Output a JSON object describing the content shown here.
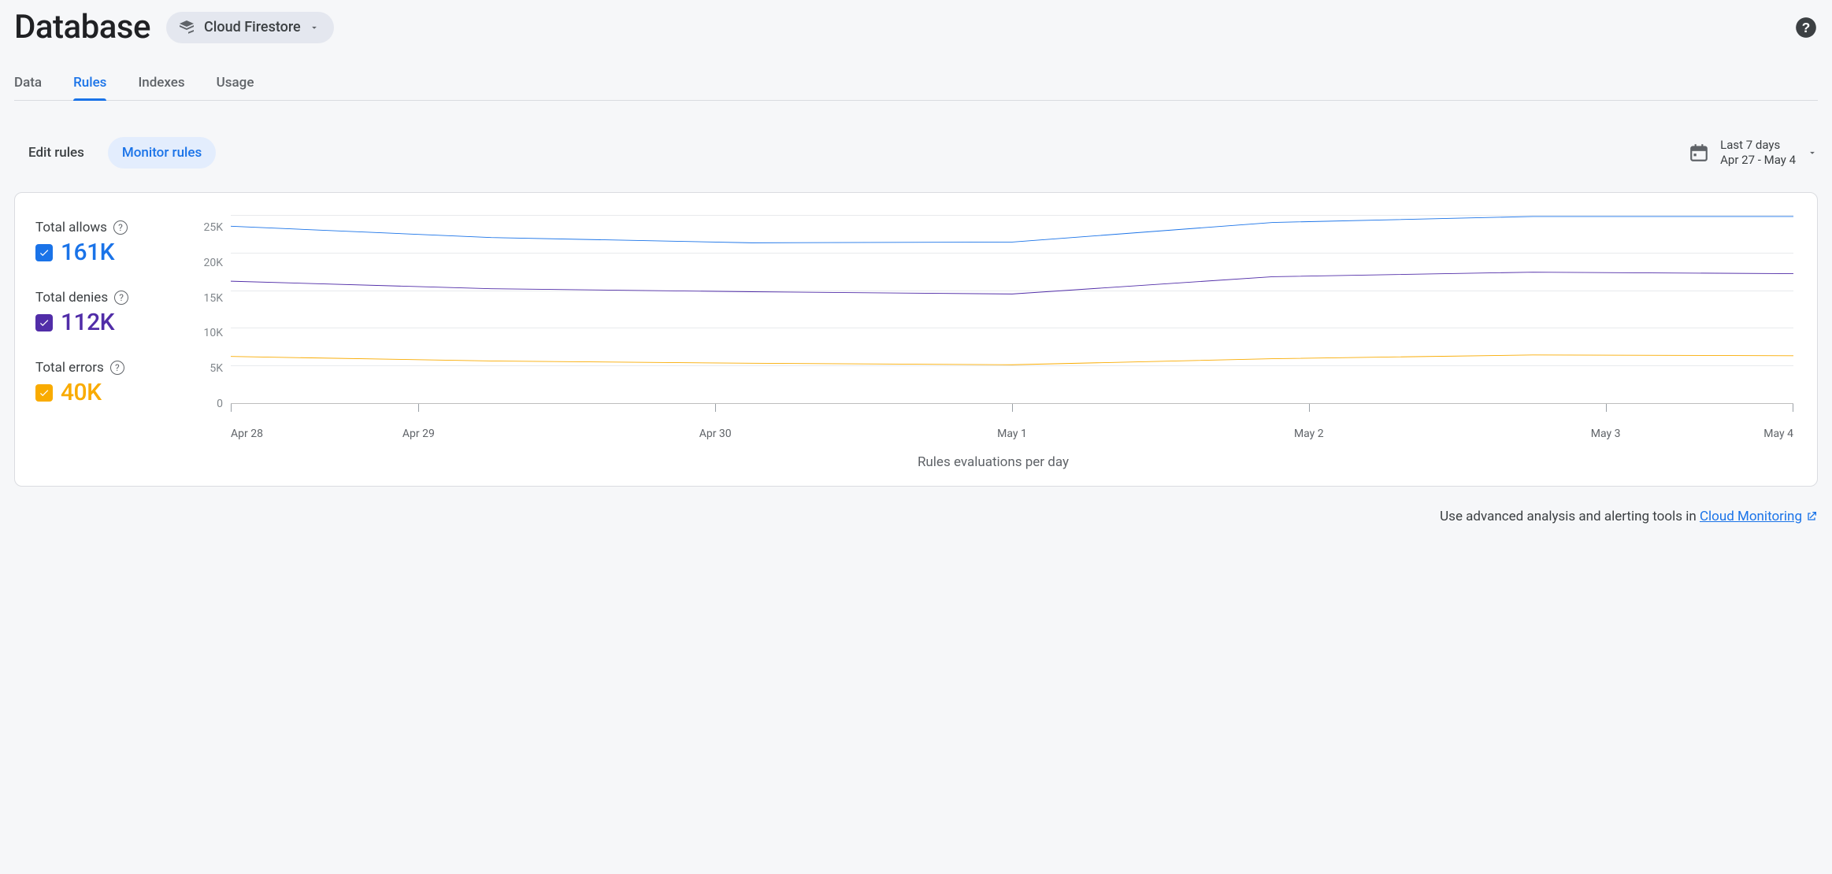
{
  "header": {
    "title": "Database",
    "chip_label": "Cloud Firestore"
  },
  "main_tabs": [
    {
      "key": "data",
      "label": "Data",
      "active": false
    },
    {
      "key": "rules",
      "label": "Rules",
      "active": true
    },
    {
      "key": "indexes",
      "label": "Indexes",
      "active": false
    },
    {
      "key": "usage",
      "label": "Usage",
      "active": false
    }
  ],
  "sub_tabs": [
    {
      "key": "edit",
      "label": "Edit rules",
      "active": false
    },
    {
      "key": "monitor",
      "label": "Monitor rules",
      "active": true
    }
  ],
  "date_range": {
    "label": "Last 7 days",
    "range": "Apr 27 - May 4"
  },
  "metrics": [
    {
      "key": "allows",
      "label": "Total allows",
      "value": "161K",
      "color": "#1a73e8"
    },
    {
      "key": "denies",
      "label": "Total denies",
      "value": "112K",
      "color": "#512da8"
    },
    {
      "key": "errors",
      "label": "Total errors",
      "value": "40K",
      "color": "#f9ab00"
    }
  ],
  "chart_data": {
    "type": "line",
    "title": "",
    "xlabel": "Rules evaluations per day",
    "ylabel": "",
    "categories": [
      "Apr 28",
      "Apr 29",
      "Apr 30",
      "May 1",
      "May 2",
      "May 3",
      "May 4"
    ],
    "y_ticks": [
      "25K",
      "20K",
      "15K",
      "10K",
      "5K",
      "0"
    ],
    "ylim": [
      0,
      25000
    ],
    "series": [
      {
        "name": "Total allows",
        "color": "#1a73e8",
        "values": [
          23500,
          22000,
          21300,
          21400,
          24000,
          24800,
          24800
        ]
      },
      {
        "name": "Total denies",
        "color": "#512da8",
        "values": [
          16200,
          15200,
          14800,
          14500,
          16800,
          17400,
          17200
        ]
      },
      {
        "name": "Total errors",
        "color": "#f9ab00",
        "values": [
          6200,
          5600,
          5300,
          5100,
          5900,
          6400,
          6300
        ]
      }
    ]
  },
  "footer": {
    "prefix": "Use advanced analysis and alerting tools in ",
    "link_text": "Cloud Monitoring"
  }
}
